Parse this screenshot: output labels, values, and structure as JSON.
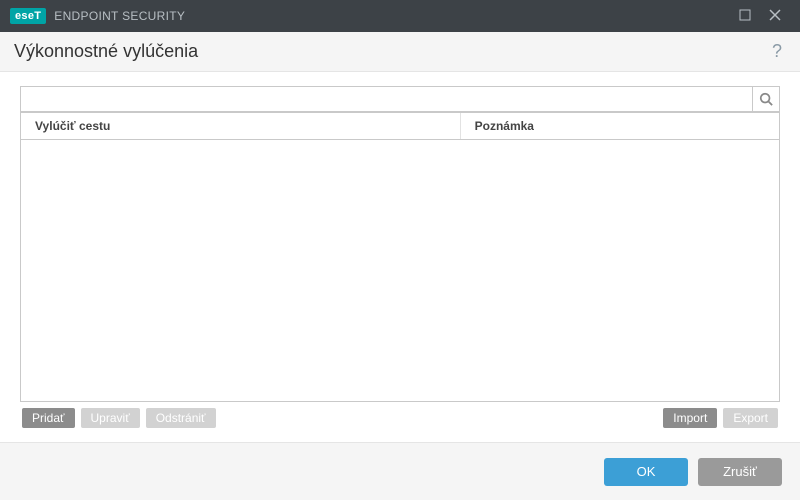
{
  "titlebar": {
    "brand_logo": "eseT",
    "brand_text": "ENDPOINT SECURITY"
  },
  "subheader": {
    "title": "Výkonnostné vylúčenia",
    "help": "?"
  },
  "search": {
    "placeholder": ""
  },
  "table": {
    "columns": {
      "path": "Vylúčiť cestu",
      "note": "Poznámka"
    }
  },
  "toolbar": {
    "add": "Pridať",
    "edit": "Upraviť",
    "delete": "Odstrániť",
    "import": "Import",
    "export": "Export"
  },
  "footer": {
    "ok": "OK",
    "cancel": "Zrušiť"
  }
}
